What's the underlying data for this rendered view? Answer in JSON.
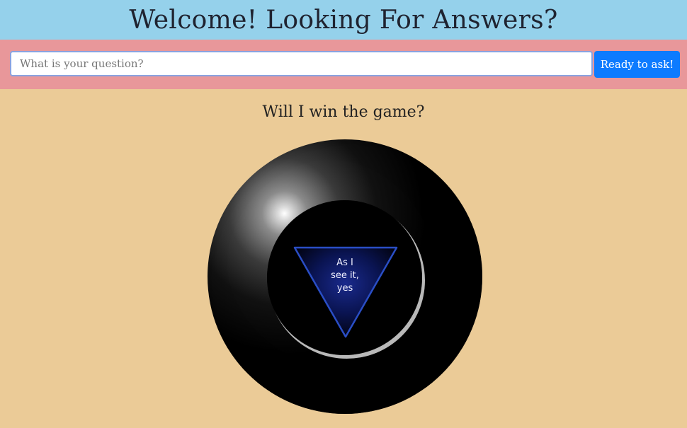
{
  "header": {
    "title": "Welcome! Looking For Answers?"
  },
  "ask_bar": {
    "input_placeholder": "What is your question?",
    "input_value": "",
    "button_label": "Ready to ask!"
  },
  "question": {
    "text": "Will I win the game?"
  },
  "eight_ball": {
    "answer_line1": "As I",
    "answer_line2": "see it,",
    "answer_line3": "yes"
  },
  "colors": {
    "header_bg": "#95d1eb",
    "askbar_bg": "#e8979a",
    "page_bg": "#ebcb97",
    "button_bg": "#0d7bff",
    "triangle_stroke": "#2a4ec5"
  }
}
